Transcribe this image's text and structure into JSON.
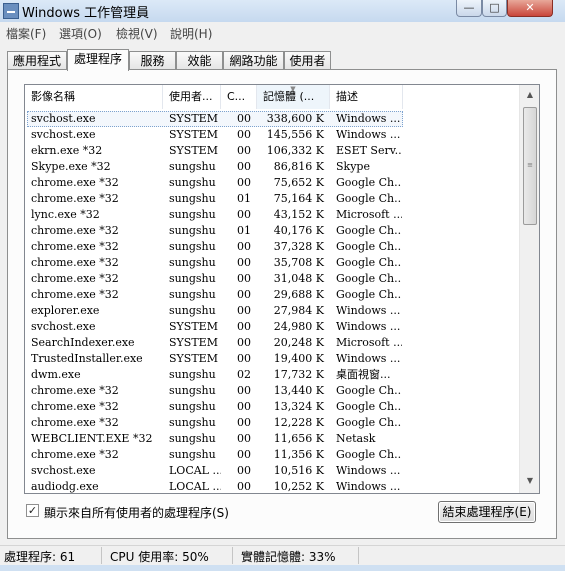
{
  "window": {
    "title": "Windows 工作管理員",
    "controls": {
      "minimize": "—",
      "maximize": "□",
      "close": "✕"
    }
  },
  "menubar": [
    "檔案(F)",
    "選項(O)",
    "檢視(V)",
    "說明(H)"
  ],
  "tabs": [
    "應用程式",
    "處理程序",
    "服務",
    "效能",
    "網路功能",
    "使用者"
  ],
  "active_tab_index": 1,
  "table": {
    "columns": [
      "影像名稱",
      "使用者...",
      "C...",
      "記憶體 (...",
      "描述"
    ],
    "sorted_column_index": 3,
    "rows": [
      [
        "svchost.exe",
        "SYSTEM",
        "00",
        "338,600 K",
        "Windows ..."
      ],
      [
        "svchost.exe",
        "SYSTEM",
        "00",
        "145,556 K",
        "Windows ..."
      ],
      [
        "ekrn.exe *32",
        "SYSTEM",
        "00",
        "106,332 K",
        "ESET Serv..."
      ],
      [
        "Skype.exe *32",
        "sungshu",
        "00",
        "86,816 K",
        "Skype"
      ],
      [
        "chrome.exe *32",
        "sungshu",
        "00",
        "75,652 K",
        "Google Ch..."
      ],
      [
        "chrome.exe *32",
        "sungshu",
        "01",
        "75,164 K",
        "Google Ch..."
      ],
      [
        "lync.exe *32",
        "sungshu",
        "00",
        "43,152 K",
        "Microsoft ..."
      ],
      [
        "chrome.exe *32",
        "sungshu",
        "01",
        "40,176 K",
        "Google Ch..."
      ],
      [
        "chrome.exe *32",
        "sungshu",
        "00",
        "37,328 K",
        "Google Ch..."
      ],
      [
        "chrome.exe *32",
        "sungshu",
        "00",
        "35,708 K",
        "Google Ch..."
      ],
      [
        "chrome.exe *32",
        "sungshu",
        "00",
        "31,048 K",
        "Google Ch..."
      ],
      [
        "chrome.exe *32",
        "sungshu",
        "00",
        "29,688 K",
        "Google Ch..."
      ],
      [
        "explorer.exe",
        "sungshu",
        "00",
        "27,984 K",
        "Windows ..."
      ],
      [
        "svchost.exe",
        "SYSTEM",
        "00",
        "24,980 K",
        "Windows ..."
      ],
      [
        "SearchIndexer.exe",
        "SYSTEM",
        "00",
        "20,248 K",
        "Microsoft ..."
      ],
      [
        "TrustedInstaller.exe",
        "SYSTEM",
        "00",
        "19,400 K",
        "Windows ..."
      ],
      [
        "dwm.exe",
        "sungshu",
        "02",
        "17,732 K",
        "桌面視窗..."
      ],
      [
        "chrome.exe *32",
        "sungshu",
        "00",
        "13,440 K",
        "Google Ch..."
      ],
      [
        "chrome.exe *32",
        "sungshu",
        "00",
        "13,324 K",
        "Google Ch..."
      ],
      [
        "chrome.exe *32",
        "sungshu",
        "00",
        "12,228 K",
        "Google Ch..."
      ],
      [
        "WEBCLIENT.EXE *32",
        "sungshu",
        "00",
        "11,656 K",
        "Netask"
      ],
      [
        "chrome.exe *32",
        "sungshu",
        "00",
        "11,356 K",
        "Google Ch..."
      ],
      [
        "svchost.exe",
        "LOCAL ...",
        "00",
        "10,516 K",
        "Windows ..."
      ],
      [
        "audiodg.exe",
        "LOCAL ...",
        "00",
        "10,252 K",
        "Windows ..."
      ]
    ],
    "selected_row_index": 0
  },
  "show_all_users": {
    "label": "顯示來自所有使用者的處理程序(S)",
    "checked": true,
    "mark": "✓"
  },
  "end_process_button": "結束處理程序(E)",
  "statusbar": {
    "processes": "處理程序: 61",
    "cpu": "CPU 使用率: 50%",
    "memory": "實體記憶體: 33%"
  }
}
